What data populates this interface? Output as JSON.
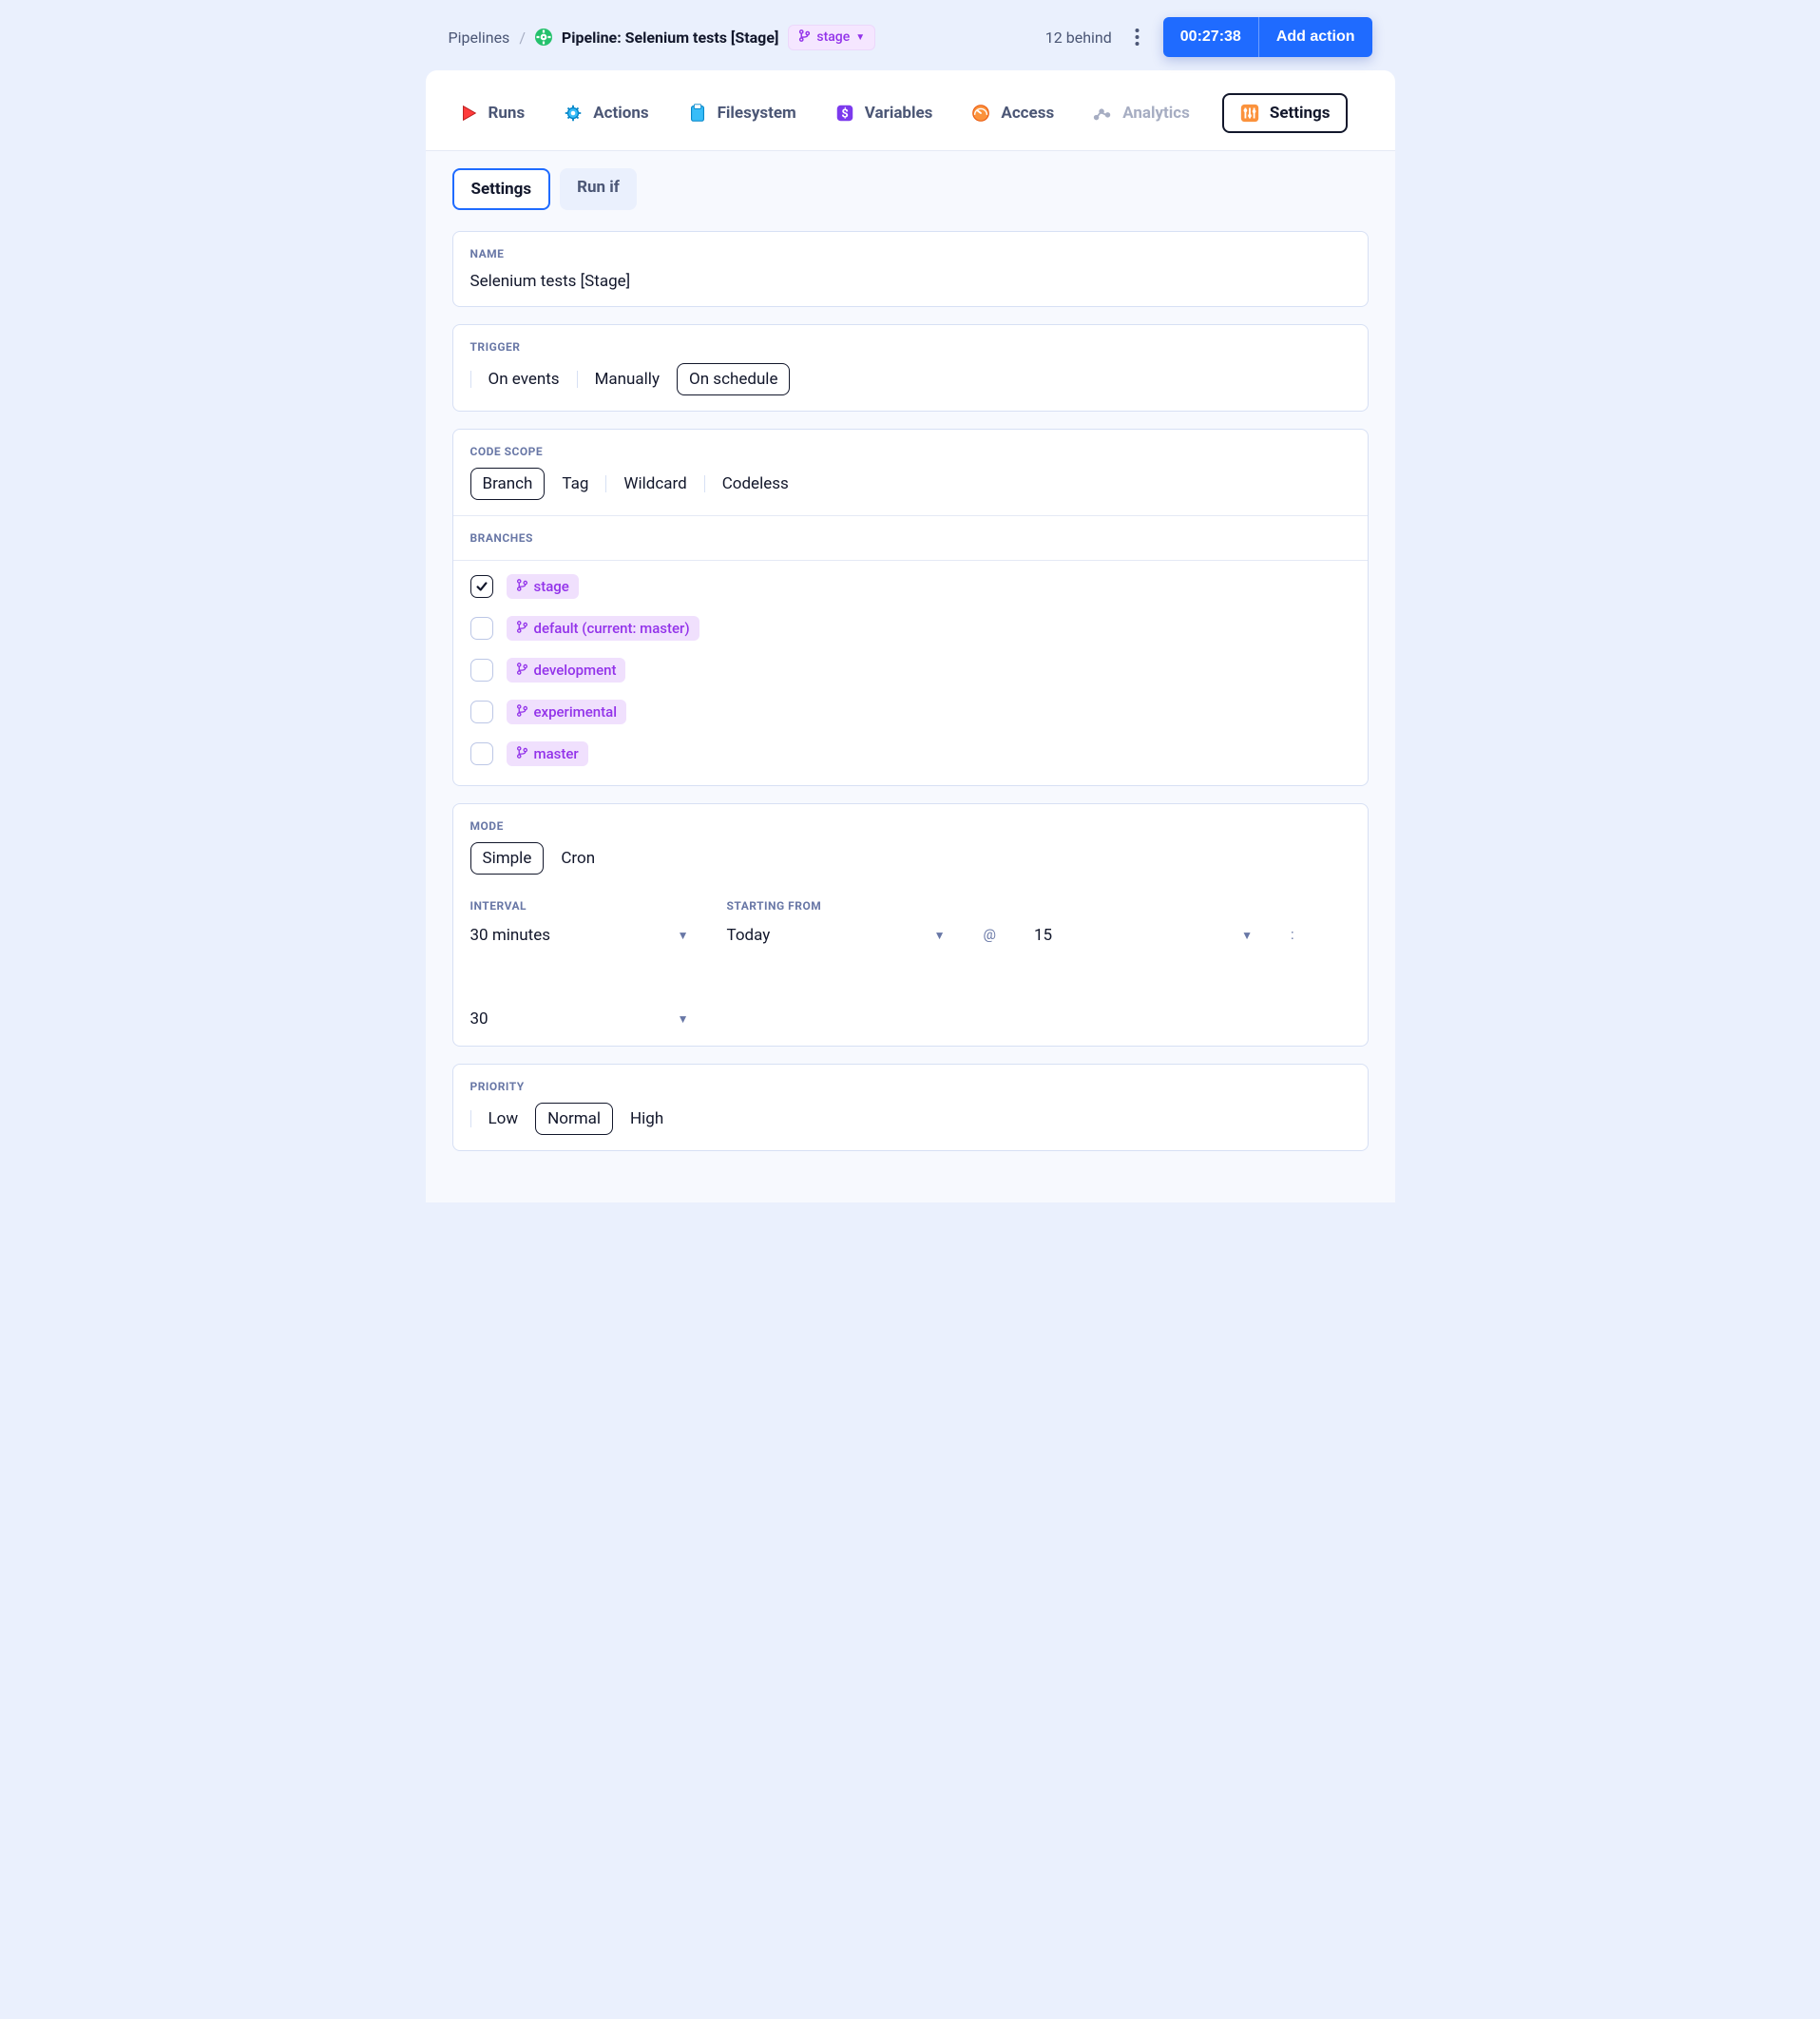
{
  "header": {
    "breadcrumb_root": "Pipelines",
    "title": "Pipeline: Selenium tests [Stage]",
    "branch_chip": "stage",
    "behind_text": "12 behind",
    "timer": "00:27:38",
    "add_action": "Add action"
  },
  "tabs": [
    {
      "key": "runs",
      "label": "Runs",
      "icon": "play"
    },
    {
      "key": "actions",
      "label": "Actions",
      "icon": "gear"
    },
    {
      "key": "filesystem",
      "label": "Filesystem",
      "icon": "clipboard"
    },
    {
      "key": "variables",
      "label": "Variables",
      "icon": "dollar"
    },
    {
      "key": "access",
      "label": "Access",
      "icon": "gauge"
    },
    {
      "key": "analytics",
      "label": "Analytics",
      "icon": "dots",
      "muted": true
    },
    {
      "key": "settings",
      "label": "Settings",
      "icon": "sliders",
      "active": true
    }
  ],
  "subtabs": {
    "settings": "Settings",
    "run_if": "Run if"
  },
  "name": {
    "label": "NAME",
    "value": "Selenium tests [Stage]"
  },
  "trigger": {
    "label": "TRIGGER",
    "options": [
      "On events",
      "Manually",
      "On schedule"
    ],
    "selected": "On schedule"
  },
  "code_scope": {
    "label": "CODE SCOPE",
    "options": [
      "Branch",
      "Tag",
      "Wildcard",
      "Codeless"
    ],
    "selected": "Branch"
  },
  "branches": {
    "label": "BRANCHES",
    "items": [
      {
        "name": "stage",
        "checked": true
      },
      {
        "name": "default (current: master)",
        "checked": false
      },
      {
        "name": "development",
        "checked": false
      },
      {
        "name": "experimental",
        "checked": false
      },
      {
        "name": "master",
        "checked": false
      }
    ]
  },
  "mode": {
    "label": "MODE",
    "options": [
      "Simple",
      "Cron"
    ],
    "selected": "Simple",
    "interval_label": "INTERVAL",
    "interval_value": "30 minutes",
    "starting_label": "STARTING FROM",
    "starting_value": "Today",
    "hour": "15",
    "minute": "30"
  },
  "priority": {
    "label": "PRIORITY",
    "options": [
      "Low",
      "Normal",
      "High"
    ],
    "selected": "Normal"
  }
}
